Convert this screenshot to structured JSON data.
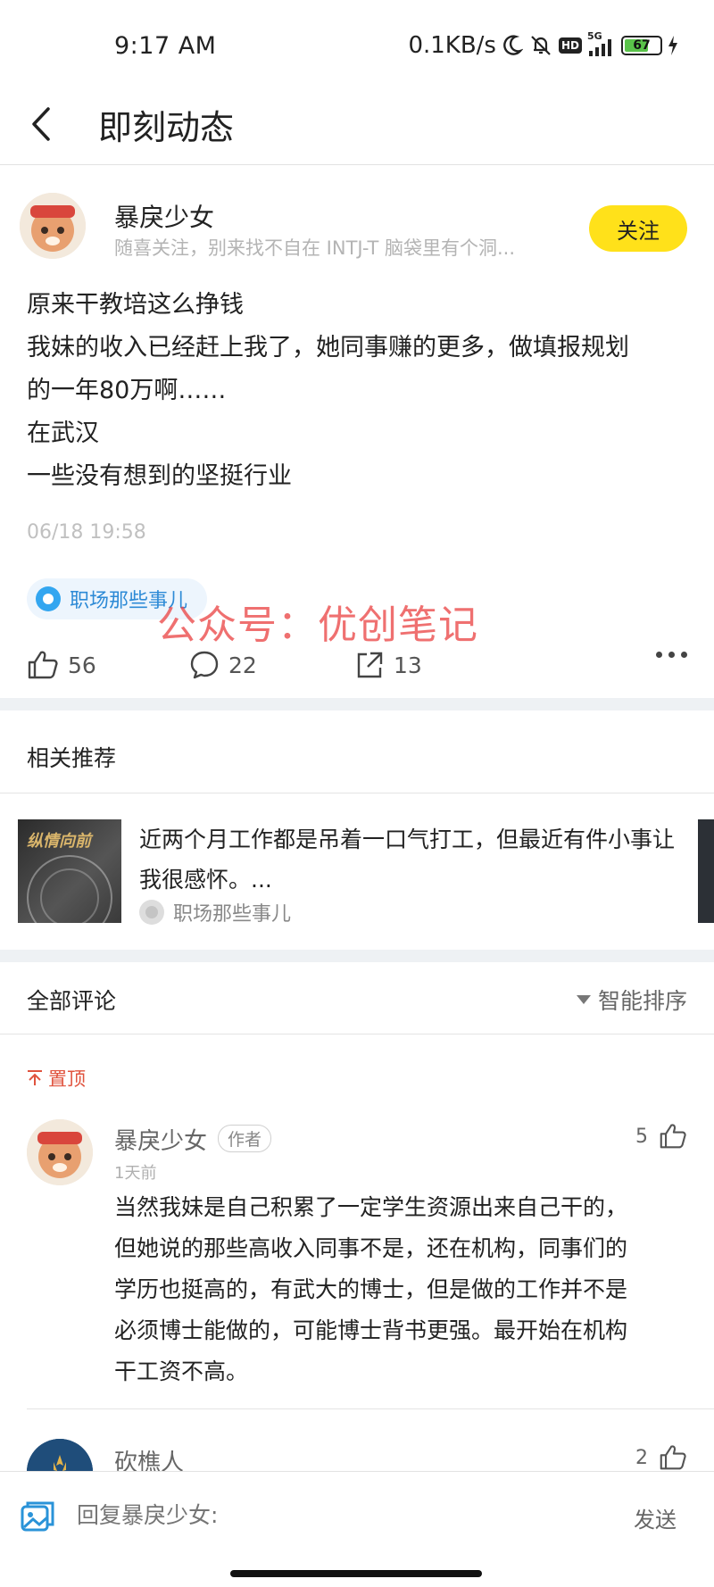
{
  "status_bar": {
    "time": "9:17 AM",
    "net_speed": "0.1KB/s",
    "network": "5G",
    "hd": "HD",
    "battery": "67"
  },
  "nav": {
    "title": "即刻动态"
  },
  "post": {
    "author_name": "暴戾少女",
    "author_signature": "随喜关注，别来找不自在  INTJ-T  脑袋里有个洞...",
    "follow_label": "关注",
    "body_lines": [
      "原来干教培这么挣钱",
      "我妹的收入已经赶上我了，她同事赚的更多，做填报规划",
      "的一年80万啊……",
      "在武汉",
      "一些没有想到的坚挺行业"
    ],
    "time": "06/18 19:58",
    "topic": "职场那些事儿",
    "watermark": "公众号：优创笔记",
    "likes": "56",
    "comments": "22",
    "shares": "13"
  },
  "recommend": {
    "section_title": "相关推荐",
    "item": {
      "title": "近两个月工作都是吊着一口气打工，但最近有件小事让我很感怀。...",
      "source": "职场那些事儿",
      "thumb_text": "纵情向前"
    }
  },
  "comments": {
    "section_title": "全部评论",
    "sort_label": "智能排序",
    "pinned_label": "置顶",
    "items": [
      {
        "name": "暴戾少女",
        "tag": "作者",
        "time": "1天前",
        "likes": "5",
        "text_lines": [
          "当然我妹是自己积累了一定学生资源出来自己干的，",
          "但她说的那些高收入同事不是，还在机构，同事们的",
          "学历也挺高的，有武大的博士，但是做的工作并不是",
          "必须博士能做的，可能博士背书更强。最开始在机构",
          "干工资不高。"
        ]
      },
      {
        "name": "砍樵人",
        "likes": "2"
      }
    ]
  },
  "reply_bar": {
    "placeholder": "回复暴戾少女:",
    "send_label": "发送"
  },
  "colors": {
    "follow_bg": "#ffe11a",
    "topic_blue": "#2d8ad6",
    "pinned_red": "#e0533e",
    "watermark_red": "#eb4848",
    "band_gray": "#eef1f4"
  }
}
